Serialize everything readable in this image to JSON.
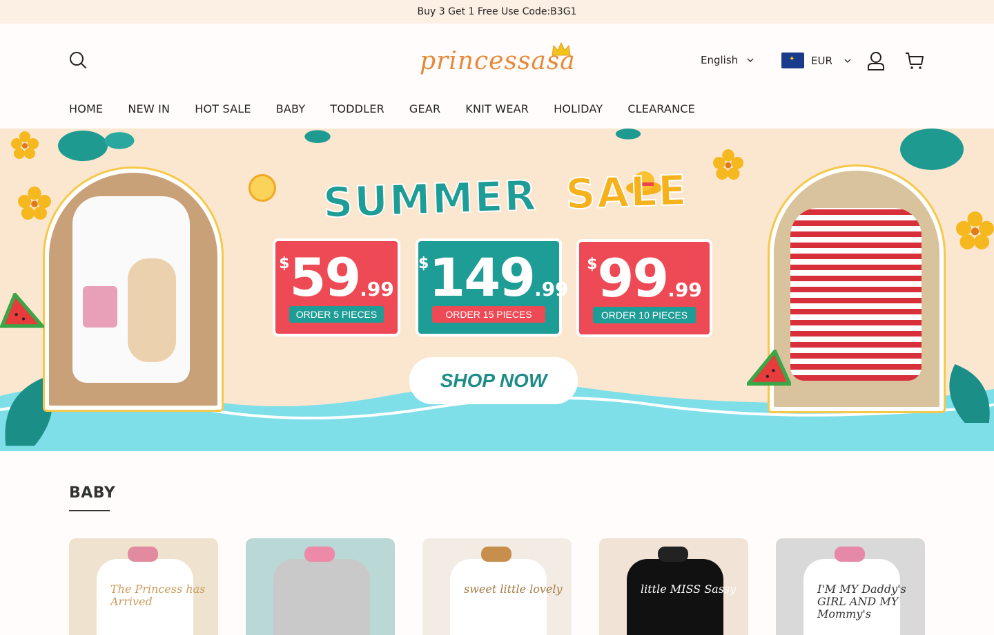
{
  "announcement": "Buy 3 Get 1 Free Use Code:B3G1",
  "header": {
    "logo_text": "princessasa",
    "language": "English",
    "currency": "EUR"
  },
  "nav": [
    "HOME",
    "NEW IN",
    "HOT SALE",
    "BABY",
    "TODDLER",
    "GEAR",
    "KNIT WEAR",
    "HOLIDAY",
    "CLEARANCE"
  ],
  "hero": {
    "title_word1": "SUMMER",
    "title_word2": "SALE",
    "currency_symbol": "$",
    "tickets": [
      {
        "dollars": "59",
        "cents": ".99",
        "label": "ORDER 5 PIECES"
      },
      {
        "dollars": "149",
        "cents": ".99",
        "label": "ORDER 15 PIECES"
      },
      {
        "dollars": "99",
        "cents": ".99",
        "label": "ORDER 10 PIECES"
      }
    ],
    "cta": "SHOP NOW"
  },
  "section": {
    "title": "BABY",
    "products": [
      {
        "bg": "#efe3cf",
        "onesie": "#ffffff",
        "text": "The Princess has Arrived",
        "text_color": "#c89a5a",
        "bow": "#e28aa0"
      },
      {
        "bg": "#b9d8d6",
        "onesie": "#c9c9c9",
        "text": "",
        "text_color": "#444444",
        "bow": "#ec8aa8"
      },
      {
        "bg": "#f2ece4",
        "onesie": "#ffffff",
        "text": "sweet little lovely",
        "text_color": "#a57a46",
        "bow": "#c88f4c"
      },
      {
        "bg": "#f1e3d6",
        "onesie": "#111111",
        "text": "little MISS Sassy",
        "text_color": "#ffffff",
        "bow": "#222222"
      },
      {
        "bg": "#d9d9d9",
        "onesie": "#ffffff",
        "text": "I'M MY Daddy's GIRL AND MY Mommy's",
        "text_color": "#333333",
        "bow": "#e689a8"
      }
    ]
  },
  "colors": {
    "teal": "#1e9c96",
    "red": "#ee4a55",
    "yellow": "#f5b21c",
    "announce_bg": "#fcefe3",
    "hero_bg": "#fbe7cf"
  }
}
